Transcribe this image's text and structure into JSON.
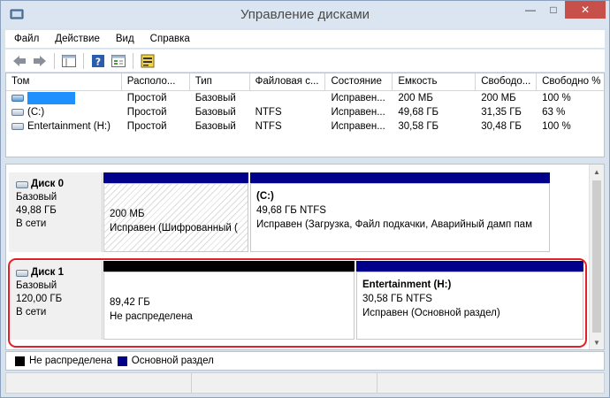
{
  "window": {
    "title": "Управление дисками"
  },
  "menu": [
    "Файл",
    "Действие",
    "Вид",
    "Справка"
  ],
  "toolbar": {
    "buttons": [
      "back-icon",
      "forward-icon",
      "console-tree-icon",
      "help-icon",
      "properties-icon",
      "disk-settings-icon"
    ]
  },
  "volumes": {
    "columns": [
      "Том",
      "Располо...",
      "Тип",
      "Файловая с...",
      "Состояние",
      "Емкость",
      "Свободо...",
      "Свободно %"
    ],
    "rows": [
      {
        "name": "",
        "layout": "Простой",
        "type": "Базовый",
        "fs": "",
        "status": "Исправен...",
        "capacity": "200 МБ",
        "free": "200 МБ",
        "free_pct": "100 %"
      },
      {
        "name": "(C:)",
        "layout": "Простой",
        "type": "Базовый",
        "fs": "NTFS",
        "status": "Исправен...",
        "capacity": "49,68 ГБ",
        "free": "31,35 ГБ",
        "free_pct": "63 %"
      },
      {
        "name": "Entertainment (H:)",
        "layout": "Простой",
        "type": "Базовый",
        "fs": "NTFS",
        "status": "Исправен...",
        "capacity": "30,58 ГБ",
        "free": "30,48 ГБ",
        "free_pct": "100 %"
      }
    ]
  },
  "disks": [
    {
      "name": "Диск 0",
      "type": "Базовый",
      "size": "49,88 ГБ",
      "state": "В сети",
      "partitions": [
        {
          "title": "",
          "size": "200 МБ",
          "status": "Исправен (Шифрованный (",
          "kind": "primary"
        },
        {
          "title": "(C:)",
          "size": "49,68 ГБ NTFS",
          "status": "Исправен (Загрузка, Файл подкачки, Аварийный дамп пам",
          "kind": "primary"
        }
      ]
    },
    {
      "name": "Диск 1",
      "type": "Базовый",
      "size": "120,00 ГБ",
      "state": "В сети",
      "partitions": [
        {
          "title": "",
          "size": "89,42 ГБ",
          "status": "Не распределена",
          "kind": "unallocated"
        },
        {
          "title": "Entertainment (H:)",
          "size": "30,58 ГБ NTFS",
          "status": "Исправен (Основной раздел)",
          "kind": "primary"
        }
      ]
    }
  ],
  "legend": [
    {
      "label": "Не распределена",
      "color": "#000000"
    },
    {
      "label": "Основной раздел",
      "color": "#00008b"
    }
  ],
  "colors": {
    "primary": "#00008b",
    "unallocated": "#000000",
    "highlight": "#e0202a"
  }
}
